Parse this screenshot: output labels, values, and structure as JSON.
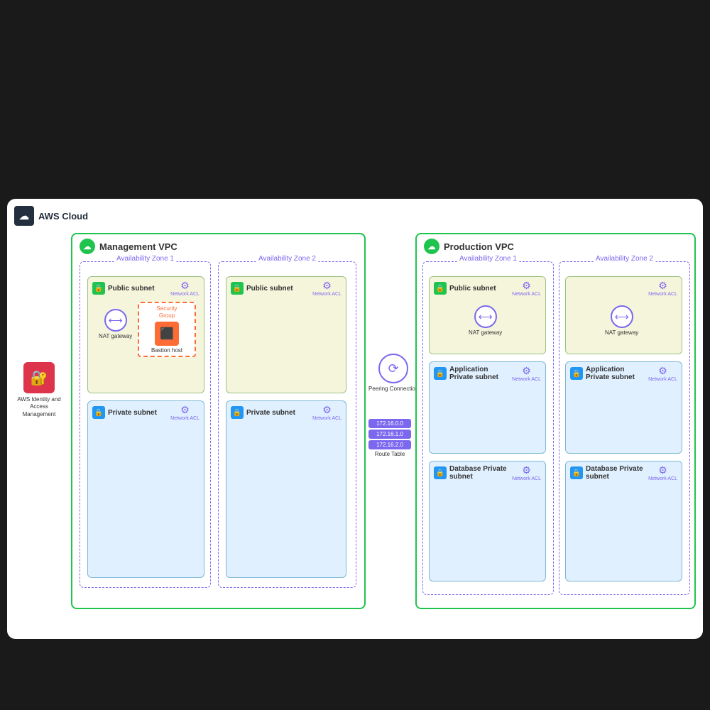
{
  "title": "AWS Cloud",
  "iam": {
    "label": "AWS Identity and Access Management",
    "icon": "🔐"
  },
  "management_vpc": {
    "title": "Management VPC",
    "az1": {
      "label": "Availability Zone 1",
      "public_subnet": {
        "title": "Public subnet",
        "network_acl": "Network ACL"
      },
      "private_subnet": {
        "title": "Private subnet",
        "network_acl": "Network ACL"
      },
      "nat_gateway": "NAT gateway",
      "security_group_label": "Security Group",
      "bastion_label": "Bastion host"
    },
    "az2": {
      "label": "Availability Zone 2",
      "public_subnet": {
        "title": "Public subnet",
        "network_acl": "Network ACL"
      },
      "private_subnet": {
        "title": "Private subnet",
        "network_acl": "Network ACL"
      }
    }
  },
  "production_vpc": {
    "title": "Production VPC",
    "az1": {
      "label": "Availability Zone 1",
      "public_subnet": {
        "title": "Public subnet",
        "network_acl": "Network ACL"
      },
      "app_subnet": {
        "title": "Application Private subnet",
        "network_acl": "Network ACL"
      },
      "db_subnet": {
        "title": "Database Private subnet",
        "network_acl": "Network ACL"
      },
      "nat_gateway": "NAT gateway"
    },
    "az2": {
      "label": "Availability Zone 2",
      "public_subnet": {
        "network_acl": "Network ACL"
      },
      "app_subnet": {
        "title": "Application Private subnet",
        "network_acl": "Network ACL"
      },
      "db_subnet": {
        "title": "Database Private subnet",
        "network_acl": "Network ACL"
      },
      "nat_gateway": "NAT gateway"
    }
  },
  "peering": {
    "label": "Peering Connection"
  },
  "route_table": {
    "rows": [
      "172.16.0.0",
      "172.16.1.0",
      "172.16.2.0"
    ],
    "label": "Route Table"
  }
}
